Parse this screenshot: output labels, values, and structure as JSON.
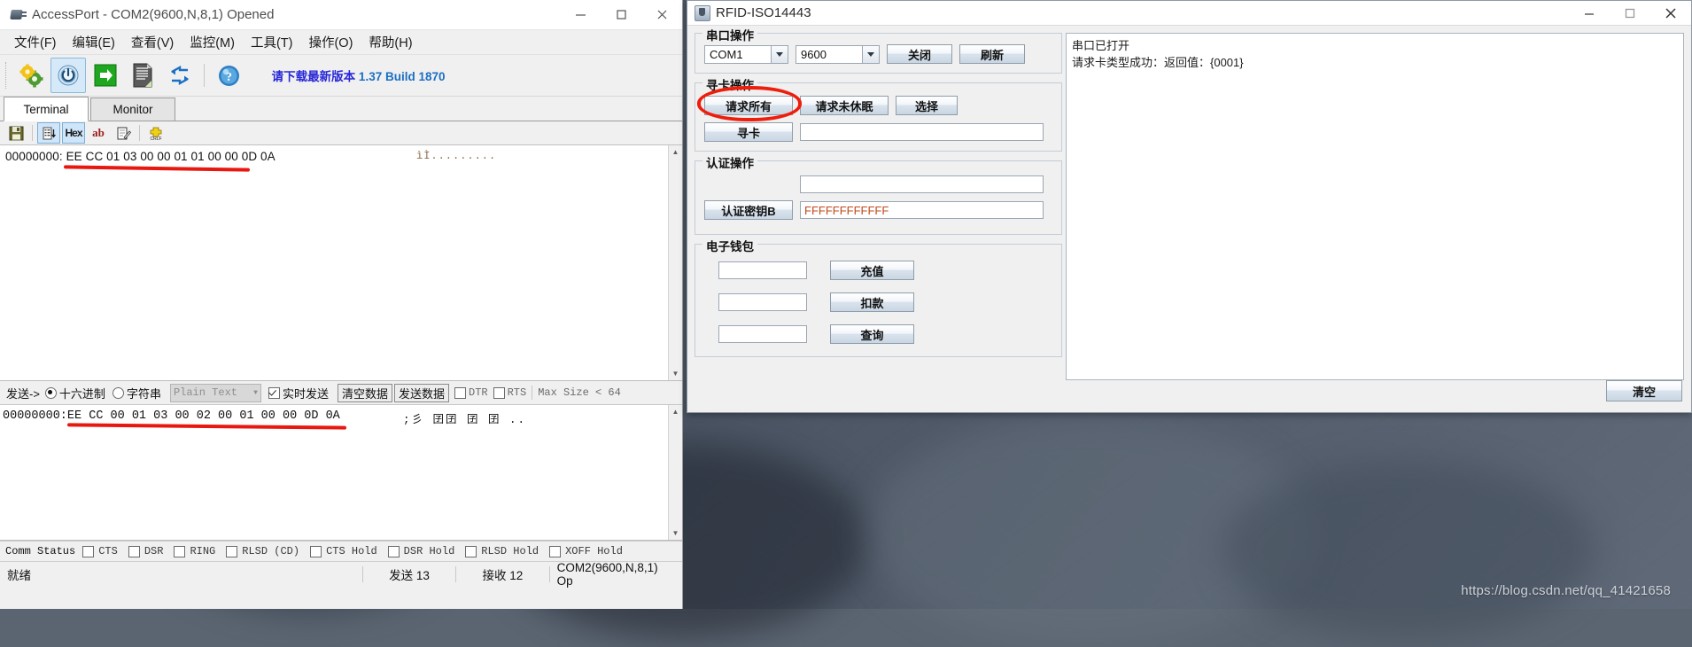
{
  "accessport": {
    "title": "AccessPort - COM2(9600,N,8,1) Opened",
    "icon": "serial-port-icon",
    "window_controls": {
      "minimize": "–",
      "maximize": "□",
      "close": "✕"
    },
    "menu": [
      {
        "label": "文件(F)",
        "mnemonic": "F"
      },
      {
        "label": "编辑(E)",
        "mnemonic": "E"
      },
      {
        "label": "查看(V)",
        "mnemonic": "V"
      },
      {
        "label": "监控(M)",
        "mnemonic": "M"
      },
      {
        "label": "工具(T)",
        "mnemonic": "T"
      },
      {
        "label": "操作(O)",
        "mnemonic": "O"
      },
      {
        "label": "帮助(H)",
        "mnemonic": "H"
      }
    ],
    "toolbar": {
      "buttons": [
        "settings-gears-icon",
        "power-toggle-icon",
        "send-arrow-icon",
        "document-icon",
        "refresh-arrows-icon",
        "help-question-icon"
      ],
      "update_notice": "请下载最新版本",
      "update_version": "1.37 Build 1870"
    },
    "tabs": [
      {
        "label": "Terminal",
        "selected": true
      },
      {
        "label": "Monitor",
        "selected": false
      }
    ],
    "subtoolbar": [
      "save-disk-icon",
      "list-down-icon",
      "hex-icon",
      "ab-text-icon",
      "edit-note-icon",
      "crlf-icon"
    ],
    "receive": {
      "offset": "00000000:",
      "hex": "EE CC 01 03 00 00 01 01 00 00 0D 0A",
      "ascii": "ìÌ........."
    },
    "send_toolbar": {
      "label": "发送->",
      "mode_hex": "十六进制",
      "mode_string": "字符串",
      "format_combo": "Plain Text",
      "realtime": "实时发送",
      "clear_data": "清空数据",
      "send_data": "发送数据",
      "dtr": "DTR",
      "rts": "RTS",
      "max_size": "Max Size < 64"
    },
    "send": {
      "offset": "00000000:",
      "hex": "EE CC 00 01 03 00 02 00 01 00 00 0D 0A",
      "ascii": ";彡 囝囝 囝 囝  .."
    },
    "comm_status": {
      "label": "Comm Status",
      "signals": [
        "CTS",
        "DSR",
        "RING",
        "RLSD (CD)",
        "CTS Hold",
        "DSR Hold",
        "RLSD Hold",
        "XOFF Hold"
      ]
    },
    "status_bar": {
      "ready": "就绪",
      "sent": "发送 13",
      "received": "接收 12",
      "port": "COM2(9600,N,8,1) Op"
    }
  },
  "rfid": {
    "title": "RFID-ISO14443",
    "icon": "java-coffee-icon",
    "window_controls": {
      "minimize": "–",
      "maximize": "□",
      "close": "✕"
    },
    "serial_group": {
      "legend": "串口操作",
      "port_value": "COM1",
      "baud_value": "9600",
      "close_button": "关闭",
      "refresh_button": "刷新"
    },
    "card_group": {
      "legend": "寻卡操作",
      "request_all": "请求所有",
      "request_awake": "请求未休眠",
      "select": "选择",
      "find_card": "寻卡",
      "find_card_value": ""
    },
    "auth_group": {
      "legend": "认证操作",
      "block_value": "",
      "auth_key_b": "认证密钥B",
      "key_value": "FFFFFFFFFFFF"
    },
    "wallet_group": {
      "legend": "电子钱包",
      "rows": [
        {
          "value": "",
          "button": "充值"
        },
        {
          "value": "",
          "button": "扣款"
        },
        {
          "value": "",
          "button": "查询"
        }
      ]
    },
    "log": [
      "串口已打开",
      "请求卡类型成功：返回值：{0001}"
    ],
    "clear_button": "清空"
  },
  "desktop": {
    "watermark": "https://blog.csdn.net/qq_41421658"
  },
  "colors": {
    "annotation_red": "#ee1d0c",
    "update_blue": "#2727d8",
    "key_orange": "#c24a1e"
  }
}
